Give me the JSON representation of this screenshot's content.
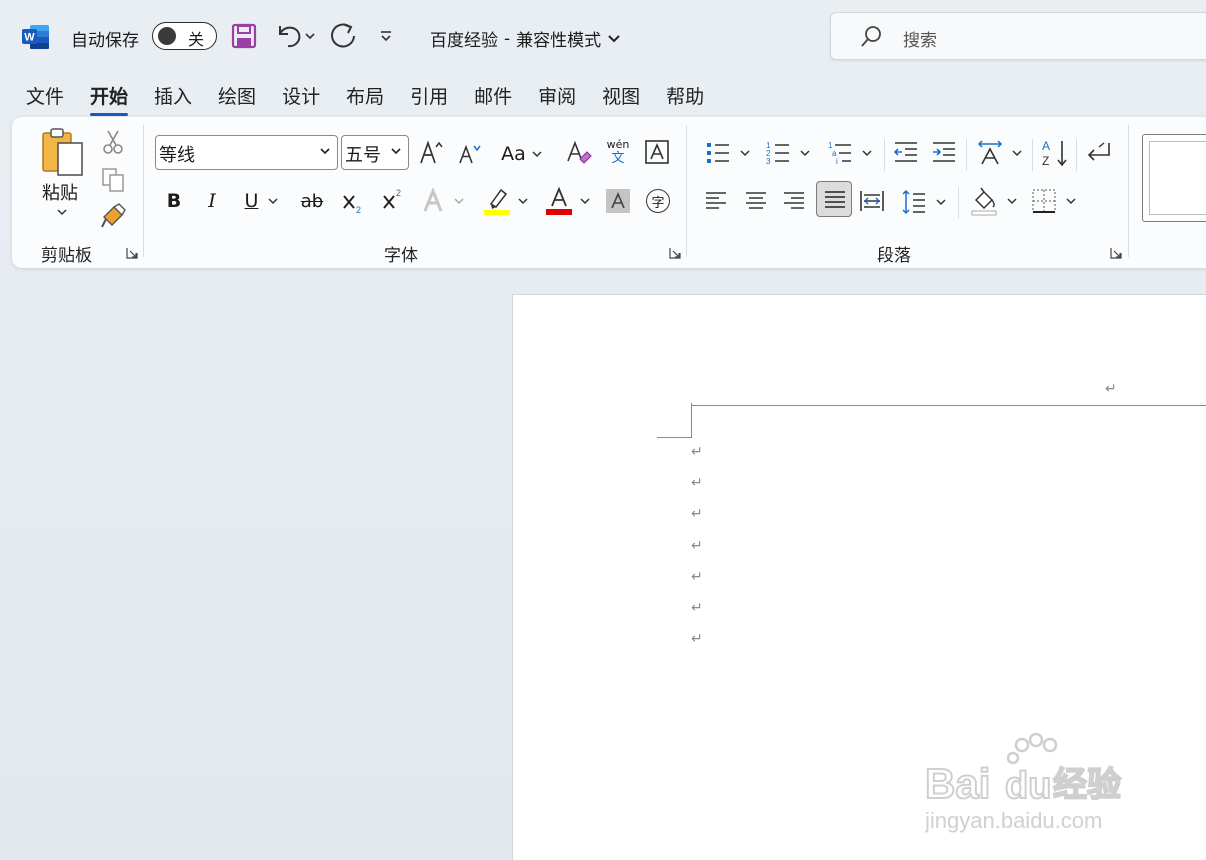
{
  "titlebar": {
    "autosave_label": "自动保存",
    "autosave_state": "关",
    "doc_title": "百度经验",
    "doc_separator": "-",
    "doc_mode": "兼容性模式",
    "search_placeholder": "搜索"
  },
  "tabs": [
    "文件",
    "开始",
    "插入",
    "绘图",
    "设计",
    "布局",
    "引用",
    "邮件",
    "审阅",
    "视图",
    "帮助"
  ],
  "active_tab": "开始",
  "ribbon": {
    "clipboard": {
      "label": "剪贴板",
      "paste": "粘贴"
    },
    "font": {
      "label": "字体",
      "font_name": "等线",
      "font_size": "五号",
      "change_case": "Aa",
      "phonetic_top": "wén",
      "phonetic_bottom": "文",
      "enclose_char": "字"
    },
    "paragraph": {
      "label": "段落"
    }
  },
  "document": {
    "paragraph_mark": "↵"
  },
  "watermark": {
    "brand": "Bai",
    "brand2": "du",
    "suffix": "经验",
    "url": "jingyan.baidu.com"
  },
  "colors": {
    "accent": "#185abd",
    "highlight": "#ffff00",
    "font_color": "#e00000",
    "word_blue": "#185abd"
  }
}
